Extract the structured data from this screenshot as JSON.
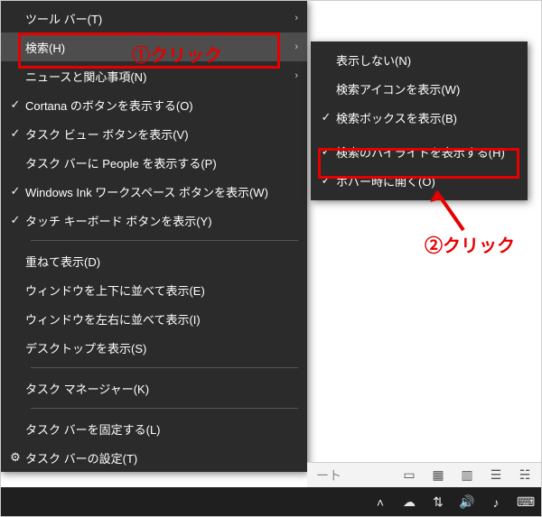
{
  "main_menu": {
    "items": [
      {
        "label": "ツール バー(T)",
        "check": "",
        "submenu": true
      },
      {
        "label": "検索(H)",
        "check": "",
        "submenu": true,
        "hover": true
      },
      {
        "label": "ニュースと関心事項(N)",
        "check": "",
        "submenu": true
      },
      {
        "label": "Cortana のボタンを表示する(O)",
        "check": "✓",
        "submenu": false
      },
      {
        "label": "タスク ビュー ボタンを表示(V)",
        "check": "✓",
        "submenu": false
      },
      {
        "label": "タスク バーに People を表示する(P)",
        "check": "",
        "submenu": false
      },
      {
        "label": "Windows Ink ワークスペース ボタンを表示(W)",
        "check": "✓",
        "submenu": false
      },
      {
        "label": "タッチ キーボード ボタンを表示(Y)",
        "check": "✓",
        "submenu": false
      }
    ],
    "group2": [
      {
        "label": "重ねて表示(D)"
      },
      {
        "label": "ウィンドウを上下に並べて表示(E)"
      },
      {
        "label": "ウィンドウを左右に並べて表示(I)"
      },
      {
        "label": "デスクトップを表示(S)"
      }
    ],
    "group3": [
      {
        "label": "タスク マネージャー(K)"
      }
    ],
    "group4": [
      {
        "label": "タスク バーを固定する(L)",
        "check": ""
      },
      {
        "label": "タスク バーの設定(T)",
        "check": "⚙"
      }
    ]
  },
  "sub_menu": {
    "items": [
      {
        "label": "表示しない(N)",
        "check": ""
      },
      {
        "label": "検索アイコンを表示(W)",
        "check": ""
      },
      {
        "label": "検索ボックスを表示(B)",
        "check": "✓"
      },
      {
        "label": "検索のハイライトを表示する(H)",
        "check": "✓",
        "highlight": true
      },
      {
        "label": "ホバー時に開く(O)",
        "check": "✓"
      }
    ]
  },
  "annotations": {
    "step1": "①クリック",
    "step2": "②クリック"
  },
  "statusbar": {
    "label": "ート"
  }
}
